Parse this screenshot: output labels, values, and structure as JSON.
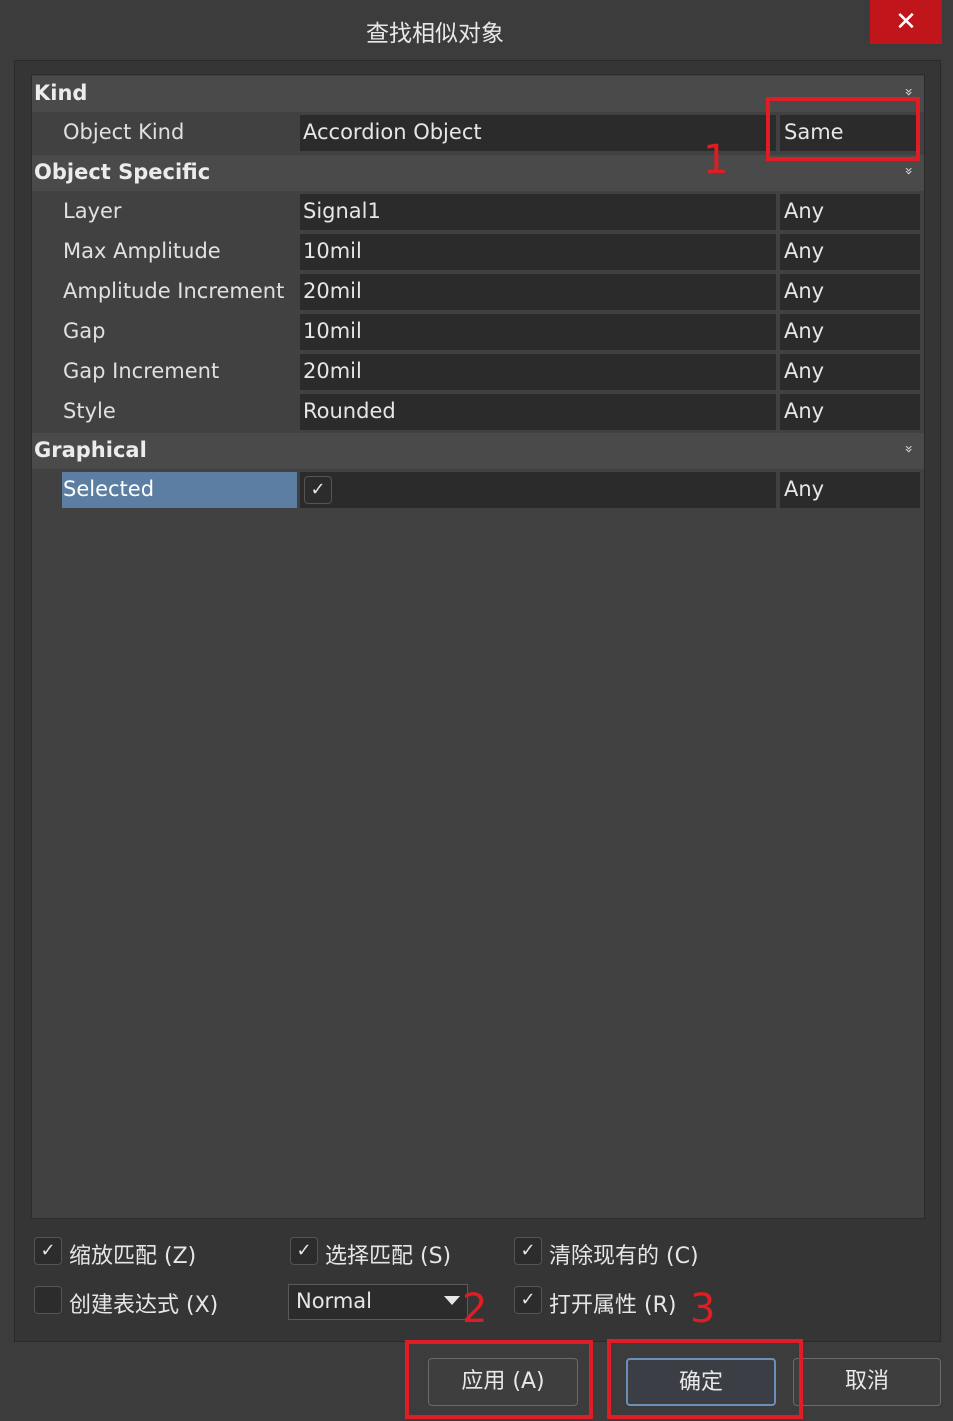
{
  "window": {
    "title": "查找相似对象",
    "close_label": "✕"
  },
  "categories": {
    "kind": "Kind",
    "object_specific": "Object Specific",
    "graphical": "Graphical"
  },
  "chevron": "»",
  "properties": {
    "object_kind": {
      "label": "Object Kind",
      "value": "Accordion Object",
      "match": "Same"
    },
    "layer": {
      "label": "Layer",
      "value": "Signal1",
      "match": "Any"
    },
    "max_amplitude": {
      "label": "Max Amplitude",
      "value": "10mil",
      "match": "Any"
    },
    "amplitude_increment": {
      "label": "Amplitude Increment",
      "value": "20mil",
      "match": "Any"
    },
    "gap": {
      "label": "Gap",
      "value": "10mil",
      "match": "Any"
    },
    "gap_increment": {
      "label": "Gap Increment",
      "value": "20mil",
      "match": "Any"
    },
    "style": {
      "label": "Style",
      "value": "Rounded",
      "match": "Any"
    },
    "selected": {
      "label": "Selected",
      "checked": "✓",
      "match": "Any"
    }
  },
  "options": {
    "zoom_matching": {
      "label": "缩放匹配 (Z)",
      "checked": "✓"
    },
    "select_matching": {
      "label": "选择匹配 (S)",
      "checked": "✓"
    },
    "clear_existing": {
      "label": "清除现有的 (C)",
      "checked": "✓"
    },
    "create_expression": {
      "label": "创建表达式 (X)",
      "checked": ""
    },
    "mask_mode": {
      "selected": "Normal"
    },
    "open_properties": {
      "label": "打开属性 (R)",
      "checked": "✓"
    }
  },
  "buttons": {
    "apply": "应用 (A)",
    "ok": "确定",
    "cancel": "取消"
  },
  "annotations": {
    "n1": "1",
    "n2": "2",
    "n3": "3",
    "color": "#e01c24"
  },
  "colors": {
    "selected_highlight": "#5d7ea3",
    "close_button": "#c0151b"
  }
}
